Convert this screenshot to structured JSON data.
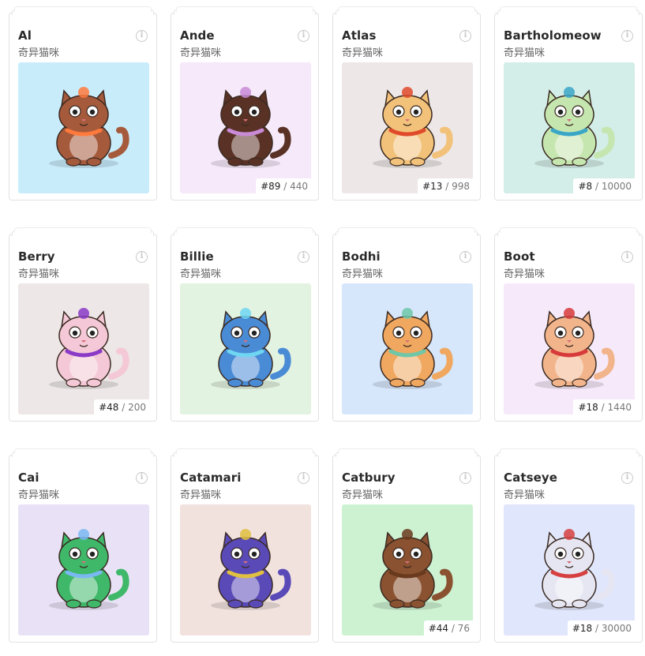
{
  "subtitle": "奇异猫咪",
  "cards": [
    {
      "name": "Al",
      "bg": "#c9ecfb",
      "edition": "",
      "supply": "",
      "fur": "#a65a3c",
      "accent": "#ff7a3c"
    },
    {
      "name": "Ande",
      "bg": "#f6e9fa",
      "edition": "#89",
      "supply": "440",
      "fur": "#5a3225",
      "accent": "#c98ad6"
    },
    {
      "name": "Atlas",
      "bg": "#ede7e7",
      "edition": "#13",
      "supply": "998",
      "fur": "#f2c27a",
      "accent": "#e04a2a"
    },
    {
      "name": "Bartholomeow",
      "bg": "#d3ede8",
      "edition": "#8",
      "supply": "10000",
      "fur": "#c6e6b0",
      "accent": "#3aa6c7"
    },
    {
      "name": "Berry",
      "bg": "#ede7e7",
      "edition": "#48",
      "supply": "200",
      "fur": "#f4c8d6",
      "accent": "#8a3ac7"
    },
    {
      "name": "Billie",
      "bg": "#e3f3e1",
      "edition": "",
      "supply": "",
      "fur": "#4a8bd6",
      "accent": "#6fd6f2"
    },
    {
      "name": "Bodhi",
      "bg": "#d6e6fb",
      "edition": "",
      "supply": "",
      "fur": "#f0a860",
      "accent": "#6fc7a8"
    },
    {
      "name": "Boot",
      "bg": "#f6e9fa",
      "edition": "#18",
      "supply": "1440",
      "fur": "#f2b48a",
      "accent": "#d63a3a"
    },
    {
      "name": "Cai",
      "bg": "#e9e2f6",
      "edition": "",
      "supply": "",
      "fur": "#3fb86a",
      "accent": "#7ab8f2"
    },
    {
      "name": "Catamari",
      "bg": "#f1e2de",
      "edition": "",
      "supply": "",
      "fur": "#5a4ab8",
      "accent": "#e0c040"
    },
    {
      "name": "Catbury",
      "bg": "#cdf2d2",
      "edition": "#44",
      "supply": "76",
      "fur": "#8a5230",
      "accent": "#6a3a1e"
    },
    {
      "name": "Catseye",
      "bg": "#e0e6fb",
      "edition": "#18",
      "supply": "30000",
      "fur": "#e6e6f2",
      "accent": "#d64040"
    }
  ]
}
